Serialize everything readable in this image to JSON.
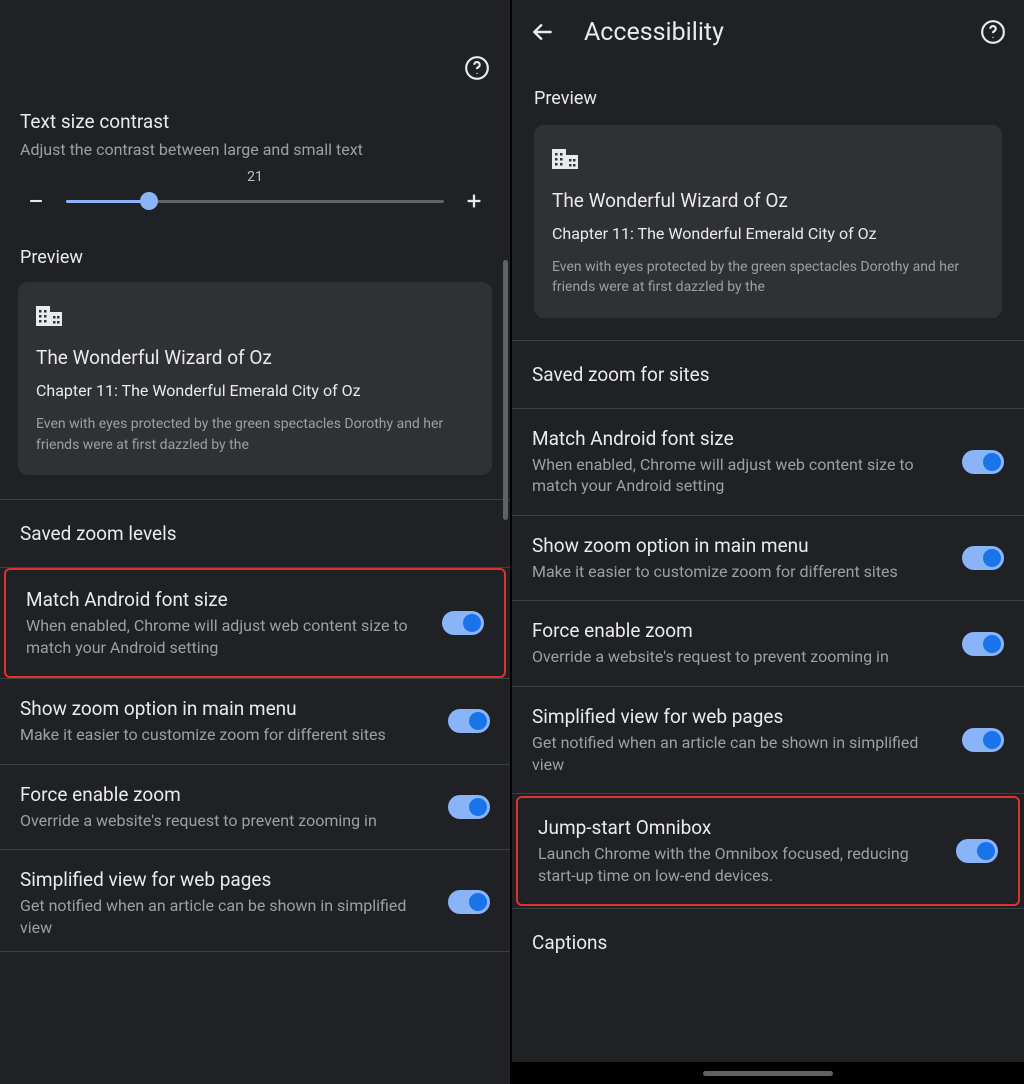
{
  "left": {
    "text_contrast": {
      "title": "Text size contrast",
      "sub": "Adjust the contrast between large and small text",
      "value": "21"
    },
    "preview_label": "Preview",
    "preview": {
      "title": "The Wonderful Wizard of Oz",
      "chapter": "Chapter 11: The Wonderful Emerald City of Oz",
      "body": "Even with eyes protected by the green spectacles Dorothy and her friends were at first dazzled by the"
    },
    "saved_zoom_label": "Saved zoom levels",
    "settings": [
      {
        "title": "Match Android font size",
        "sub": "When enabled, Chrome will adjust web content size to match your Android setting"
      },
      {
        "title": "Show zoom option in main menu",
        "sub": "Make it easier to customize zoom for different sites"
      },
      {
        "title": "Force enable zoom",
        "sub": "Override a website's request to prevent zooming in"
      },
      {
        "title": "Simplified view for web pages",
        "sub": "Get notified when an article can be shown in simplified view"
      }
    ]
  },
  "right": {
    "header_title": "Accessibility",
    "preview_label": "Preview",
    "preview": {
      "title": "The Wonderful Wizard of Oz",
      "chapter": "Chapter 11: The Wonderful Emerald City of Oz",
      "body": "Even with eyes protected by the green spectacles Dorothy and her friends were at first dazzled by the"
    },
    "saved_zoom_label": "Saved zoom for sites",
    "settings": [
      {
        "title": "Match Android font size",
        "sub": "When enabled, Chrome will adjust web content size to match your Android setting"
      },
      {
        "title": "Show zoom option in main menu",
        "sub": "Make it easier to customize zoom for different sites"
      },
      {
        "title": "Force enable zoom",
        "sub": "Override a website's request to prevent zooming in"
      },
      {
        "title": "Simplified view for web pages",
        "sub": "Get notified when an article can be shown in simplified view"
      },
      {
        "title": "Jump-start Omnibox",
        "sub": "Launch Chrome with the Omnibox focused, reducing start-up time on low-end devices."
      }
    ],
    "captions_label": "Captions"
  }
}
